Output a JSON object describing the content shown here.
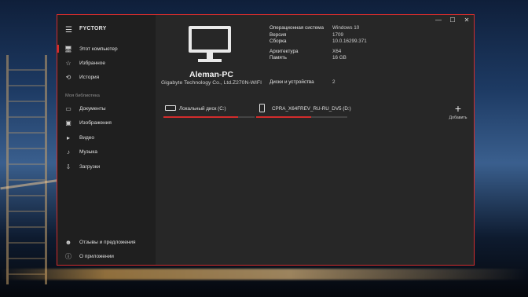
{
  "app": {
    "title": "FYCTORY"
  },
  "window_controls": {
    "minimize": "—",
    "maximize": "☐",
    "close": "✕"
  },
  "sidebar": {
    "items_top": [
      {
        "label": "Этот компьютер",
        "icon": "monitor-icon",
        "glyph": "🖥"
      },
      {
        "label": "Избранное",
        "icon": "star-icon",
        "glyph": "☆"
      },
      {
        "label": "История",
        "icon": "clock-icon",
        "glyph": "⟲"
      }
    ],
    "section_label": "Моя библиотека",
    "items_library": [
      {
        "label": "Документы",
        "icon": "document-icon",
        "glyph": "▭"
      },
      {
        "label": "Изображения",
        "icon": "image-icon",
        "glyph": "▣"
      },
      {
        "label": "Видео",
        "icon": "video-icon",
        "glyph": "▸"
      },
      {
        "label": "Музыка",
        "icon": "music-icon",
        "glyph": "♪"
      },
      {
        "label": "Загрузки",
        "icon": "download-icon",
        "glyph": "⇩"
      }
    ],
    "items_bottom": [
      {
        "label": "Отзывы и предложения",
        "icon": "feedback-icon",
        "glyph": "☻"
      },
      {
        "label": "О приложении",
        "icon": "info-icon",
        "glyph": "ⓘ"
      }
    ]
  },
  "pc": {
    "name": "Aleman-PC",
    "model": "Gigabyte Technology Co., Ltd.Z270N-WIFI"
  },
  "system_info": {
    "os_label": "Операционная система",
    "os_value": "Windows 10",
    "version_label": "Версия",
    "version_value": "1709",
    "build_label": "Сборка",
    "build_value": "10.0.16299.371",
    "arch_label": "Архитектура",
    "arch_value": "X64",
    "memory_label": "Память",
    "memory_value": "16 GB",
    "drives_label": "Диски и устройства",
    "drives_value": "2"
  },
  "drives": [
    {
      "label": "Локальный диск (C:)",
      "type": "hdd-icon",
      "fill": 0.82
    },
    {
      "label": "CPRA_X64FREV_RU-RU_DV5 (D:)",
      "type": "usb-icon",
      "fill": 0.6
    }
  ],
  "add_button": {
    "label": "Добавить",
    "glyph": "+"
  },
  "colors": {
    "accent": "#d22c2c",
    "window_bg": "#272727",
    "sidebar_bg": "#1f1f1f"
  }
}
